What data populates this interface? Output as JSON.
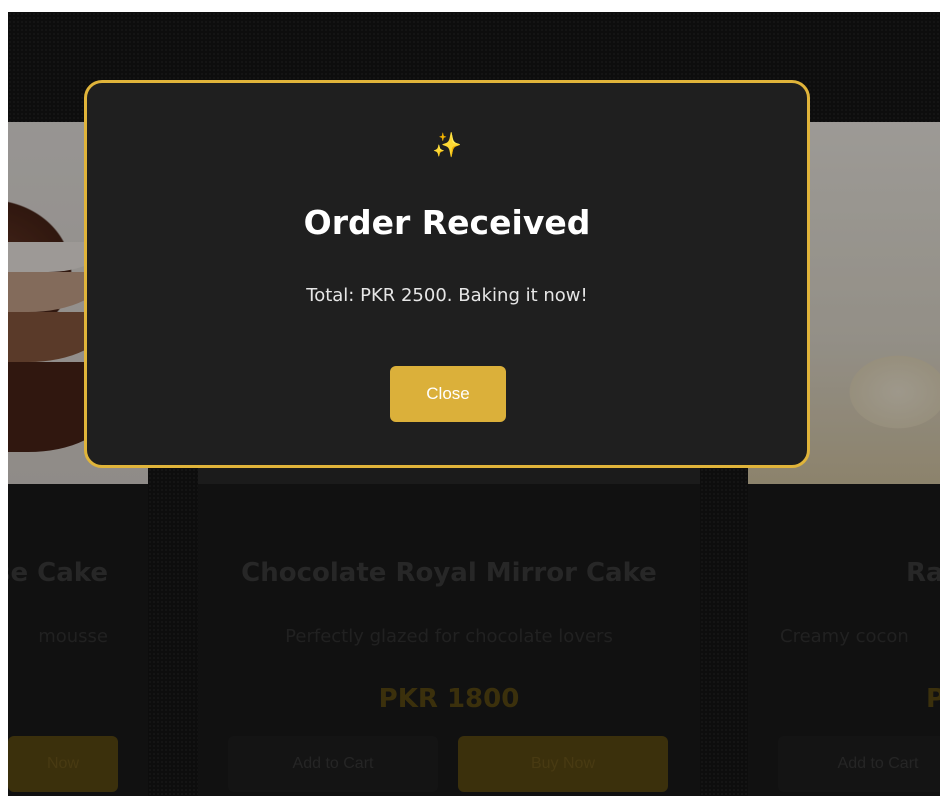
{
  "products": [
    {
      "title": "se Cake",
      "desc": "mousse",
      "price": "",
      "cart_label": "",
      "buy_label": "Now"
    },
    {
      "title": "Chocolate Royal Mirror Cake",
      "desc": "Perfectly glazed for chocolate lovers",
      "price": "PKR 1800",
      "cart_label": "Add to Cart",
      "buy_label": "Buy Now"
    },
    {
      "title": "Ra",
      "desc": "Creamy cocon",
      "price": "P",
      "cart_label": "Add to Cart",
      "buy_label": ""
    }
  ],
  "modal": {
    "icon": "sparkles-icon",
    "icon_glyph": "✨",
    "title": "Order Received",
    "message": "Total: PKR 2500. Baking it now!",
    "close_label": "Close"
  },
  "colors": {
    "accent": "#dbb03a",
    "modal_border": "#e0b43a",
    "modal_bg": "#1f1f1f",
    "page_bg": "#141414"
  }
}
